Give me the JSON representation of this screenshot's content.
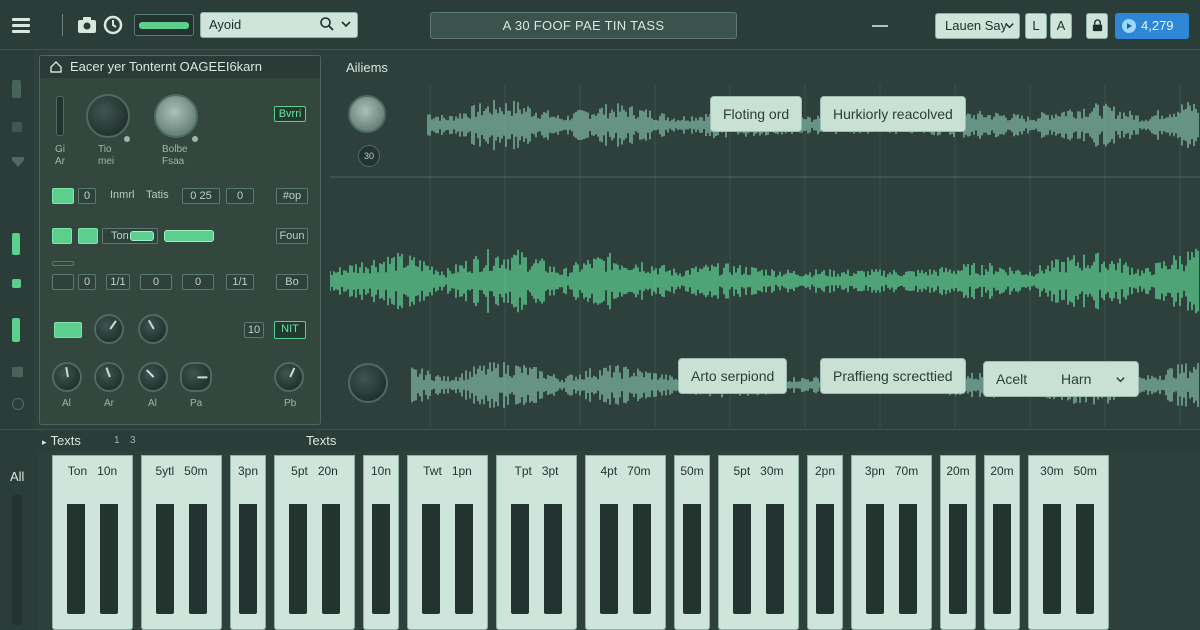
{
  "topbar": {
    "search_value": "Ayoid",
    "title": "A 30 FOOF PAE TIN TASS",
    "user_select": "Lauen Say",
    "btn_a": "L",
    "btn_b": "A",
    "count": "4,279"
  },
  "panel": {
    "title": "Eacer yer Tonternt OAGEEI6karn",
    "top_tag": "Bvrri",
    "knob_labels": [
      "Gi",
      "Ar",
      "Tio",
      "mei",
      "Bolbe",
      "Fsaa"
    ],
    "row1": [
      "0",
      "Inmrl",
      "Tatis",
      "0 25",
      "0",
      "#op"
    ],
    "row2": [
      "Ton",
      "Foun"
    ],
    "row3": [
      "0",
      "1/1",
      "0",
      "0",
      "1/1",
      "Bo"
    ],
    "row4": [
      "10",
      "NIT"
    ],
    "row5_labels": [
      "Al",
      "Ar",
      "Al",
      "Pa",
      "Pb"
    ]
  },
  "waveform": {
    "title": "Ailiems",
    "knob_label": "30",
    "labels_top": [
      "Floting ord",
      "Hurkiorly reacolved"
    ],
    "labels_bottom": [
      "Arto serpiond",
      "Praffieng screcttied"
    ],
    "select_label": "Acelt",
    "select_value": "Harn"
  },
  "keyboard": {
    "bar_left": "Texts",
    "bar_nums": [
      "1",
      "3"
    ],
    "bar_center": "Texts",
    "side_label": "All",
    "keys": [
      "Ton",
      "10n",
      "5ytl",
      "50m",
      "3pn",
      "5pt",
      "20n",
      "10n",
      "Twt",
      "1pn",
      "Tpt",
      "3pt",
      "4pt",
      "70m",
      "50m",
      "5pt",
      "30m",
      "2pn",
      "3pn",
      "70m",
      "20m",
      "20m",
      "30m",
      "50m"
    ]
  },
  "colors": {
    "background": "#2e403c",
    "accent_green": "#5ccf8f",
    "accent_blue": "#2f86d6",
    "light_key": "#cfe4da"
  }
}
